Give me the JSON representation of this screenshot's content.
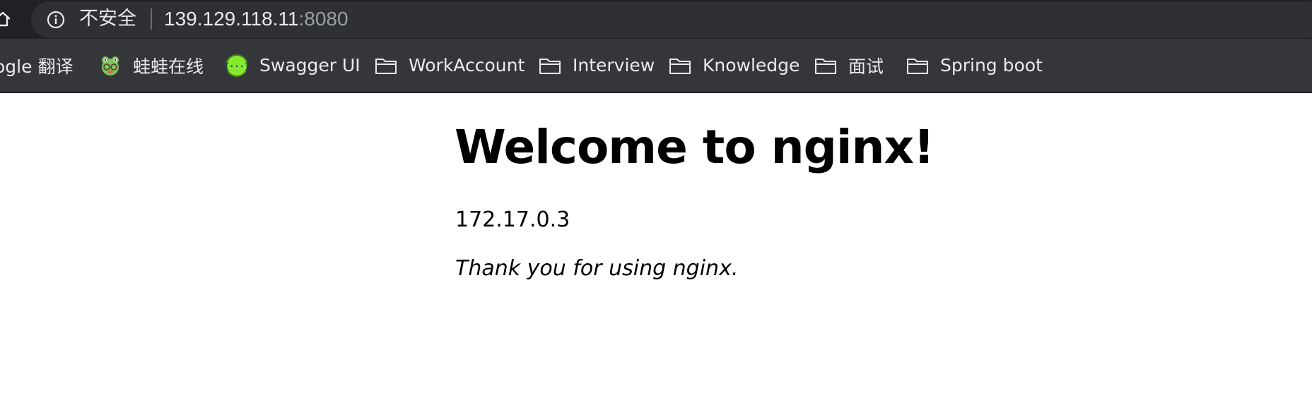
{
  "address_bar": {
    "security_label": "不安全",
    "url_host": "139.129.118.11",
    "url_port": ":8080"
  },
  "bookmarks": [
    {
      "label": "ogle 翻译",
      "icon": "google-translate-icon"
    },
    {
      "label": "蛙蛙在线",
      "icon": "frog-avatar-icon"
    },
    {
      "label": "Swagger UI",
      "icon": "swagger-icon"
    },
    {
      "label": "WorkAccount",
      "icon": "folder-icon"
    },
    {
      "label": "Interview",
      "icon": "folder-icon"
    },
    {
      "label": "Knowledge",
      "icon": "folder-icon"
    },
    {
      "label": "面试",
      "icon": "folder-icon"
    },
    {
      "label": "Spring boot",
      "icon": "folder-icon"
    }
  ],
  "page": {
    "title": "Welcome to nginx!",
    "ip": "172.17.0.3",
    "message": "Thank you for using nginx."
  },
  "colors": {
    "toolbar_bg": "#202124",
    "bookmark_bar_bg": "#35363a",
    "swagger_green": "#85ea2d"
  }
}
